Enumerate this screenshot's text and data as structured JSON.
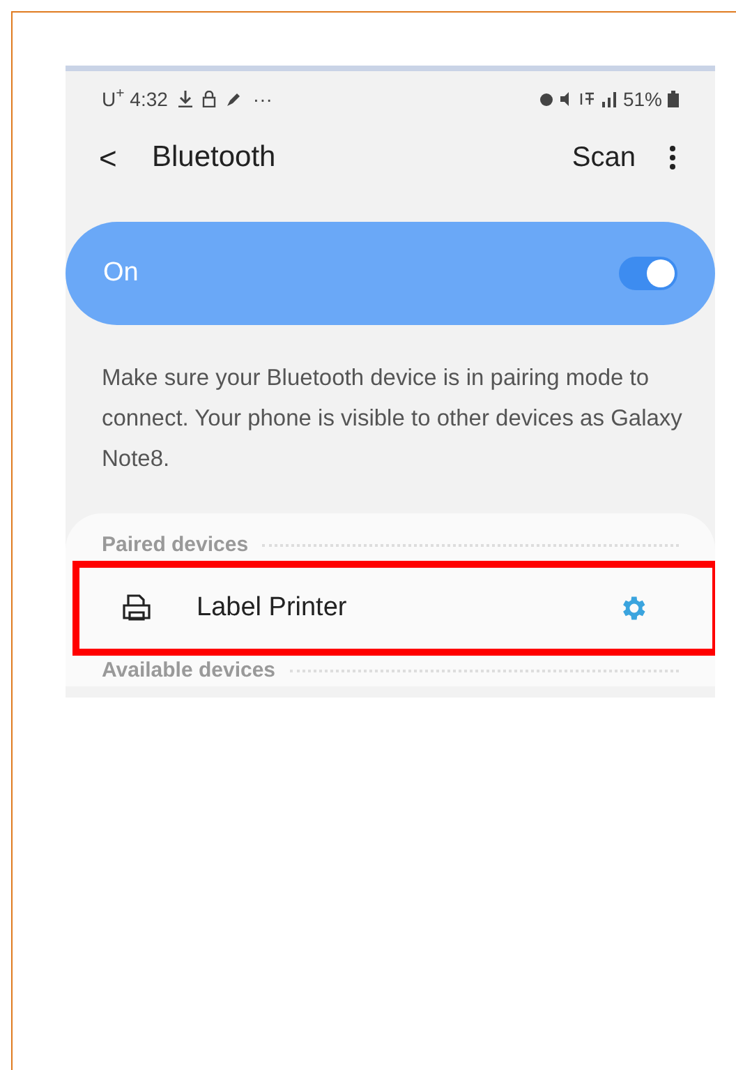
{
  "status_bar": {
    "carrier_time": "U$^{+}$ 4:32",
    "more": "···",
    "battery": "51%"
  },
  "header": {
    "back": "<",
    "title": "Bluetooth",
    "action": "Scan"
  },
  "toggle": {
    "label": "On",
    "on": true
  },
  "description": "Make sure your Bluetooth device is in pairing mode to connect. Your phone is visible to other devices as Galaxy Note8.",
  "sections": [
    {
      "title": "Paired devices",
      "devices": [
        {
          "name": "Label Printer",
          "highlighted": true
        }
      ]
    },
    {
      "title": "Available devices"
    }
  ]
}
